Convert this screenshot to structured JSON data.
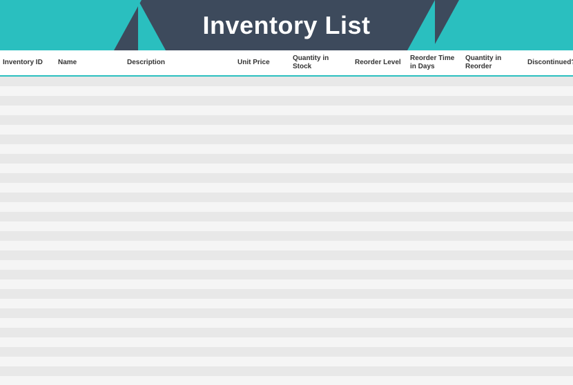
{
  "header": {
    "title": "Inventory List",
    "accent_color": "#2abfbf",
    "bg_color": "#3d4a5c"
  },
  "columns": [
    {
      "key": "inventory_id",
      "label": "Inventory ID"
    },
    {
      "key": "name",
      "label": "Name"
    },
    {
      "key": "description",
      "label": "Description"
    },
    {
      "key": "unit_price",
      "label": "Unit Price"
    },
    {
      "key": "qty_in_stock",
      "label": "Quantity in Stock"
    },
    {
      "key": "reorder_level",
      "label": "Reorder Level"
    },
    {
      "key": "reorder_time",
      "label": "Reorder Time in Days"
    },
    {
      "key": "qty_in_reorder",
      "label": "Quantity in Reorder"
    },
    {
      "key": "discontinued",
      "label": "Discontinued?"
    }
  ],
  "rows": []
}
